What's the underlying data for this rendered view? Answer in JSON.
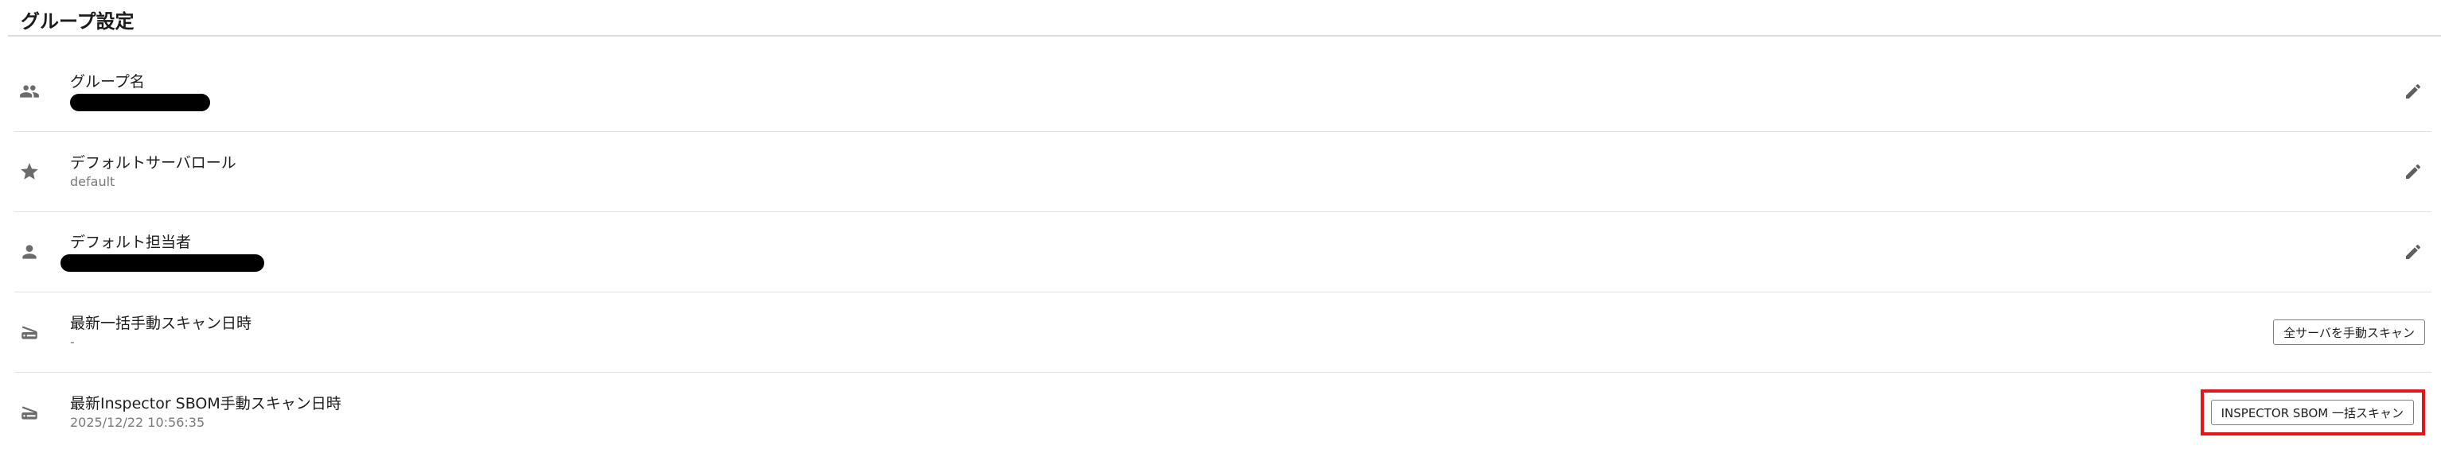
{
  "page": {
    "title": "グループ設定"
  },
  "rows": [
    {
      "label": "グループ名",
      "value": "",
      "icon": "group-icon",
      "redacted": true,
      "action": "edit-icon"
    },
    {
      "label": "デフォルトサーバロール",
      "value": "default",
      "icon": "star-icon",
      "redacted": false,
      "action": "edit-icon"
    },
    {
      "label": "デフォルト担当者",
      "value": "",
      "icon": "person-icon",
      "redacted": true,
      "action": "edit-icon"
    },
    {
      "label": "最新一括手動スキャン日時",
      "value": "-",
      "icon": "scanner-icon",
      "button_label": "全サーバを手動スキャン"
    },
    {
      "label": "最新Inspector SBOM手動スキャン日時",
      "value": "2025/12/22 10:56:35",
      "icon": "scanner-icon",
      "button_label": "INSPECTOR SBOM 一括スキャン",
      "highlight_color": "#e0161c"
    }
  ]
}
